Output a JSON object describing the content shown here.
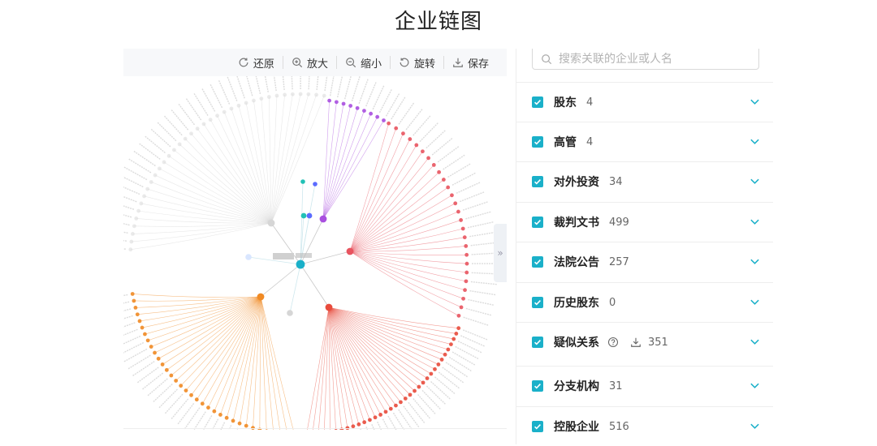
{
  "page_title": "企业链图",
  "toolbar": {
    "items": [
      {
        "label": "还原",
        "icon": "restore-icon"
      },
      {
        "label": "放大",
        "icon": "zoom-in-icon"
      },
      {
        "label": "缩小",
        "icon": "zoom-out-icon"
      },
      {
        "label": "旋转",
        "icon": "rotate-icon"
      },
      {
        "label": "保存",
        "icon": "download-icon"
      }
    ]
  },
  "search": {
    "placeholder": "搜索关联的企业或人名",
    "value": ""
  },
  "filters": [
    {
      "label": "股东",
      "count": "4",
      "checked": true
    },
    {
      "label": "高管",
      "count": "4",
      "checked": true
    },
    {
      "label": "对外投资",
      "count": "34",
      "checked": true
    },
    {
      "label": "裁判文书",
      "count": "499",
      "checked": true
    },
    {
      "label": "法院公告",
      "count": "257",
      "checked": true
    },
    {
      "label": "历史股东",
      "count": "0",
      "checked": true
    },
    {
      "label": "疑似关系",
      "count": "351",
      "checked": true,
      "help_icon": "question-circle-icon",
      "download_icon": "download-icon"
    },
    {
      "label": "分支机构",
      "count": "31",
      "checked": true
    },
    {
      "label": "控股企业",
      "count": "516",
      "checked": true
    }
  ],
  "colors": {
    "accent": "#1ab0c9",
    "investment": "#e8545f",
    "court": "#e84b3c",
    "shareholder": "#21c1b6",
    "executive": "#5b6bff",
    "branch": "#a94fdf",
    "related": "#f08a24",
    "history": "#d6d6d6"
  }
}
